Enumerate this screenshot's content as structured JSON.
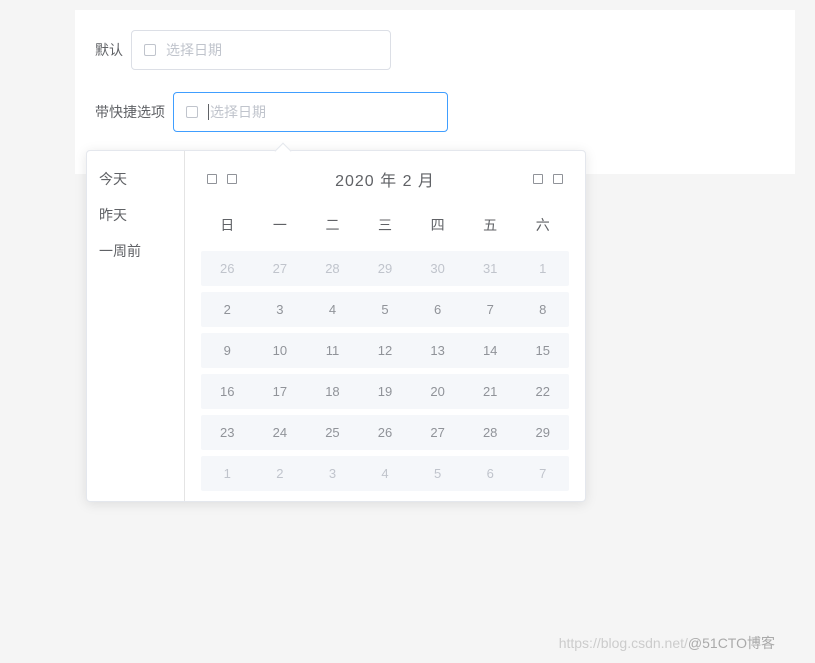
{
  "labels": {
    "default": "默认",
    "withShortcuts": "带快捷选项"
  },
  "input": {
    "placeholder": "选择日期"
  },
  "shortcuts": {
    "today": "今天",
    "yesterday": "昨天",
    "weekAgo": "一周前"
  },
  "calendar": {
    "title": "2020 年  2 月",
    "weekdays": [
      "日",
      "一",
      "二",
      "三",
      "四",
      "五",
      "六"
    ],
    "weeks": [
      {
        "days": [
          "26",
          "27",
          "28",
          "29",
          "30",
          "31",
          "1"
        ],
        "type": "prev"
      },
      {
        "days": [
          "2",
          "3",
          "4",
          "5",
          "6",
          "7",
          "8"
        ],
        "type": "current"
      },
      {
        "days": [
          "9",
          "10",
          "11",
          "12",
          "13",
          "14",
          "15"
        ],
        "type": "current"
      },
      {
        "days": [
          "16",
          "17",
          "18",
          "19",
          "20",
          "21",
          "22"
        ],
        "type": "current"
      },
      {
        "days": [
          "23",
          "24",
          "25",
          "26",
          "27",
          "28",
          "29"
        ],
        "type": "current"
      },
      {
        "days": [
          "1",
          "2",
          "3",
          "4",
          "5",
          "6",
          "7"
        ],
        "type": "next"
      }
    ]
  },
  "watermark": {
    "csdn": "https://blog.csdn.net/",
    "cto": "@51CTO博客"
  }
}
